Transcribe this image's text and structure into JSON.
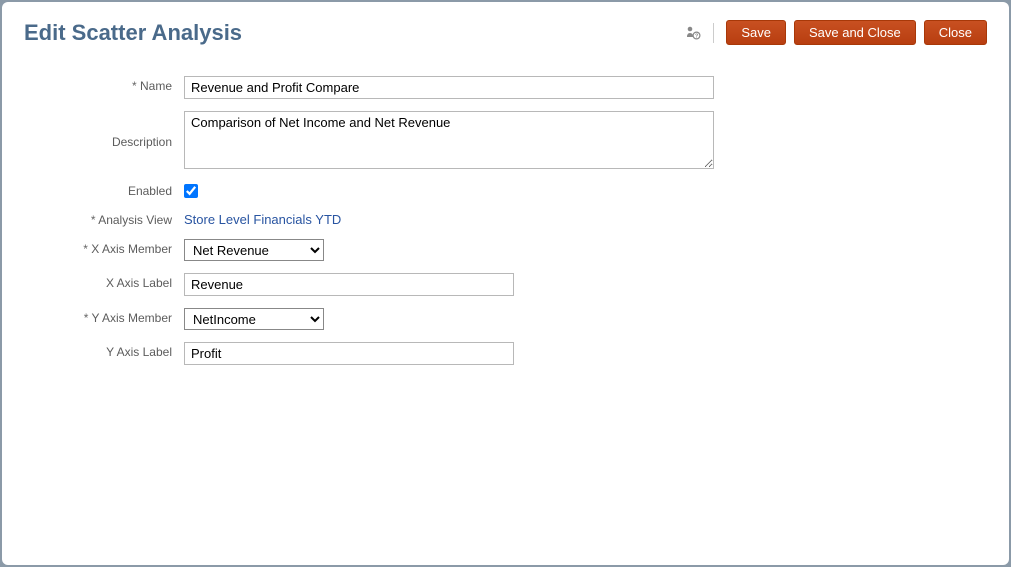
{
  "title": "Edit Scatter Analysis",
  "actions": {
    "save": "Save",
    "saveClose": "Save and Close",
    "close": "Close"
  },
  "labels": {
    "name": "Name",
    "description": "Description",
    "enabled": "Enabled",
    "analysisView": "Analysis View",
    "xAxisMember": "X Axis Member",
    "xAxisLabel": "X Axis Label",
    "yAxisMember": "Y Axis Member",
    "yAxisLabel": "Y Axis Label"
  },
  "fields": {
    "name": "Revenue and Profit Compare",
    "description": "Comparison of Net Income and Net Revenue",
    "enabled": true,
    "analysisView": "Store Level Financials YTD",
    "xAxisMember": "Net Revenue",
    "xAxisLabel": "Revenue",
    "yAxisMember": "NetIncome",
    "yAxisLabel": "Profit"
  }
}
